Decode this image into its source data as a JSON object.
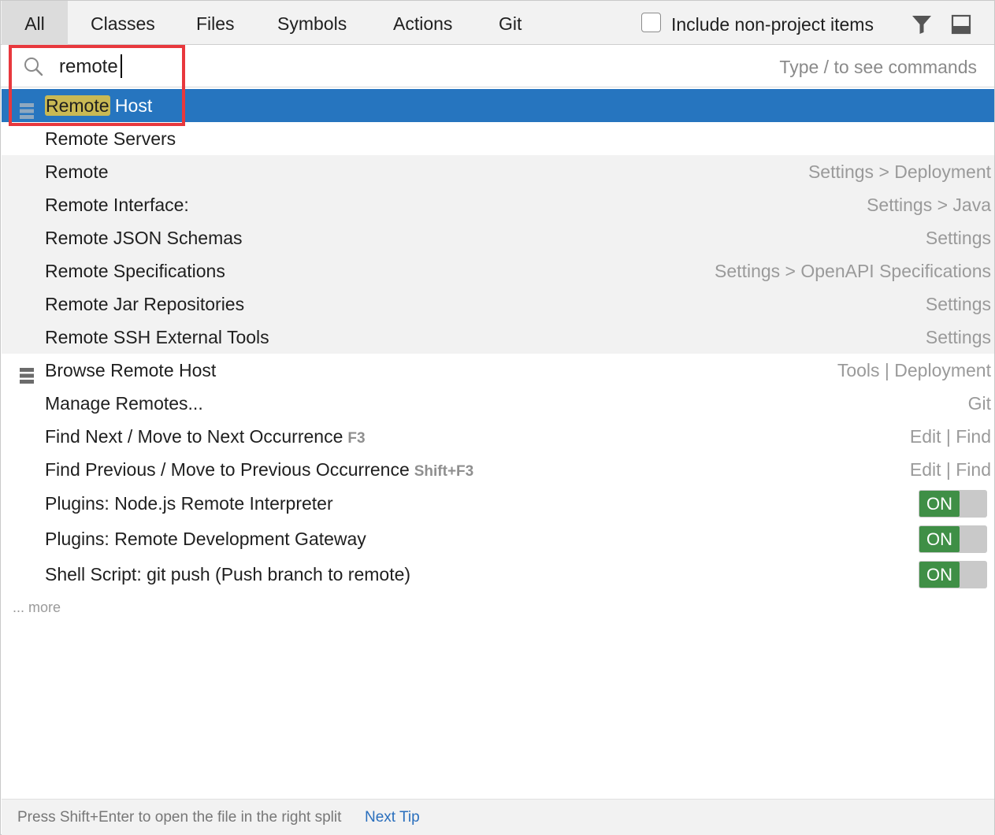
{
  "tabs": {
    "all": "All",
    "classes": "Classes",
    "files": "Files",
    "symbols": "Symbols",
    "actions": "Actions",
    "git": "Git"
  },
  "toolbar": {
    "include_non_project_label": "Include non-project items",
    "include_non_project_checked": false
  },
  "search": {
    "value": "remote",
    "hint": "Type / to see commands"
  },
  "results": [
    {
      "label_highlight": "Remote",
      "label_rest": " Host",
      "location": "",
      "icon": "server-icon",
      "selected": true
    },
    {
      "label": "Remote Servers",
      "location": ""
    },
    {
      "label": "Remote",
      "location": "Settings > Deployment"
    },
    {
      "label": "Remote Interface:",
      "location": "Settings > Java"
    },
    {
      "label": "Remote JSON Schemas",
      "location": "Settings"
    },
    {
      "label": "Remote Specifications",
      "location": "Settings > OpenAPI Specifications"
    },
    {
      "label": "Remote Jar Repositories",
      "location": "Settings"
    },
    {
      "label": "Remote SSH External Tools",
      "location": "Settings"
    },
    {
      "label": "Browse Remote Host",
      "location": "Tools | Deployment",
      "icon": "server-icon"
    },
    {
      "label": "Manage Remotes...",
      "location": "Git"
    },
    {
      "label": "Find Next / Move to Next Occurrence",
      "shortcut": "F3",
      "location": "Edit | Find"
    },
    {
      "label": "Find Previous / Move to Previous Occurrence",
      "shortcut": "Shift+F3",
      "location": "Edit | Find"
    },
    {
      "label": "Plugins: Node.js Remote Interpreter",
      "toggle": "ON"
    },
    {
      "label": "Plugins: Remote Development Gateway",
      "toggle": "ON"
    },
    {
      "label": "Shell Script: git push (Push branch to remote)",
      "toggle": "ON"
    }
  ],
  "more_label": "... more",
  "footer": {
    "tip": "Press Shift+Enter to open the file in the right split",
    "next_tip": "Next Tip"
  },
  "colors": {
    "selection": "#2675bf",
    "highlight": "#c9b954",
    "toggle_on": "#3f8f46",
    "annotation": "#e8383d",
    "link": "#2a6fbd"
  }
}
